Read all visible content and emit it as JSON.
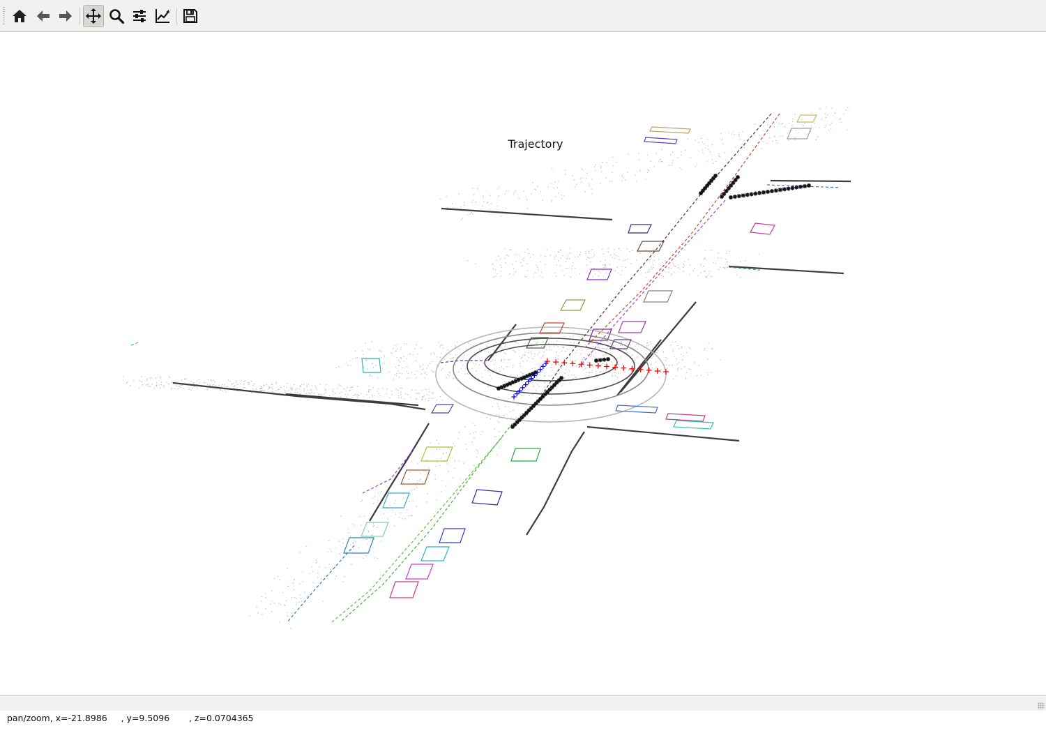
{
  "toolbar": {
    "buttons": [
      {
        "name": "home",
        "icon": "home-icon",
        "tooltip": "Reset original view"
      },
      {
        "name": "back",
        "icon": "arrow-left-icon",
        "tooltip": "Back to previous view"
      },
      {
        "name": "forward",
        "icon": "arrow-right-icon",
        "tooltip": "Forward to next view"
      },
      {
        "name": "pan",
        "icon": "move-arrows-icon",
        "active": true
      },
      {
        "name": "zoom",
        "icon": "magnifier-icon"
      },
      {
        "name": "subplots",
        "icon": "sliders-icon"
      },
      {
        "name": "edit-axis",
        "icon": "line-chart-icon"
      },
      {
        "name": "save",
        "icon": "floppy-disk-icon"
      }
    ]
  },
  "figure": {
    "title": "Trajectory"
  },
  "status": {
    "text": "pan/zoom, x=-21.8986     , y=9.5096       , z=0.0704365"
  },
  "colors": {
    "toolbar_bg": "#f2f1f0",
    "ego_past_markers": "#0000ff",
    "ego_future_markers": "#ff0000",
    "prediction_markers": "#000000",
    "point_cloud": "#8a8a8a"
  }
}
